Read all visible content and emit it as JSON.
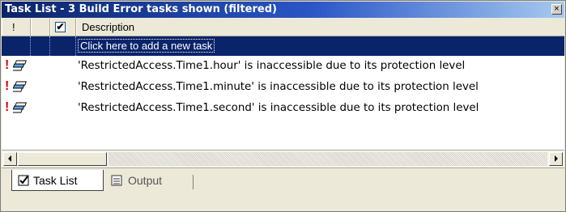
{
  "window": {
    "title": "Task List - 3 Build Error tasks shown (filtered)",
    "close_icon": "close-icon"
  },
  "columns": {
    "priority": "!",
    "checked": "✔",
    "description": "Description"
  },
  "add_row": {
    "label": "Click here to add a new task"
  },
  "tasks": [
    {
      "priority": "!",
      "icon": "build-error-icon",
      "description": "'RestrictedAccess.Time1.hour' is inaccessible due to its protection level"
    },
    {
      "priority": "!",
      "icon": "build-error-icon",
      "description": "'RestrictedAccess.Time1.minute' is inaccessible due to its protection level"
    },
    {
      "priority": "!",
      "icon": "build-error-icon",
      "description": "'RestrictedAccess.Time1.second' is inaccessible due to its protection level"
    }
  ],
  "tabs": [
    {
      "label": "Task List",
      "icon": "task-list-icon",
      "active": true
    },
    {
      "label": "Output",
      "icon": "output-icon",
      "active": false
    }
  ],
  "colors": {
    "title_bar": "#0a246a",
    "selection": "#0a246a",
    "priority_high": "#e00000"
  }
}
